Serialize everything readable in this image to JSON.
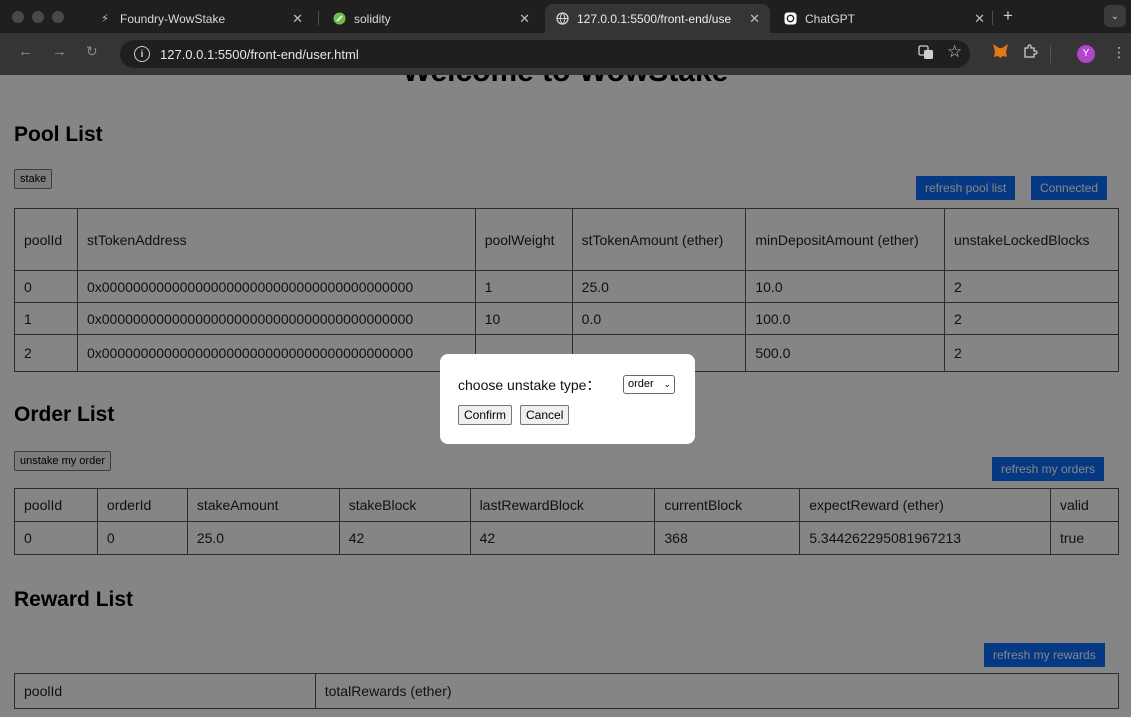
{
  "browser": {
    "tabs": [
      {
        "title": "Foundry-WowStake",
        "icon": "foundry-icon"
      },
      {
        "title": "solidity",
        "icon": "solidity-icon"
      },
      {
        "title": "127.0.0.1:5500/front-end/use",
        "icon": "globe-icon"
      },
      {
        "title": "ChatGPT",
        "icon": "chatgpt-icon"
      }
    ],
    "url": "127.0.0.1:5500/front-end/user.html",
    "profile_initial": "Y"
  },
  "page": {
    "welcome": "Welcome to WowStake",
    "pool": {
      "heading": "Pool List",
      "stake_label": "stake",
      "refresh_label": "refresh pool list",
      "connected_label": "Connected",
      "columns": [
        "poolId",
        "stTokenAddress",
        "poolWeight",
        "stTokenAmount (ether)",
        "minDepositAmount (ether)",
        "unstakeLockedBlocks"
      ],
      "rows": [
        [
          "0",
          "0x0000000000000000000000000000000000000000",
          "1",
          "25.0",
          "10.0",
          "2"
        ],
        [
          "1",
          "0x0000000000000000000000000000000000000000",
          "10",
          "0.0",
          "100.0",
          "2"
        ],
        [
          "2",
          "0x0000000000000000000000000000000000000000",
          "",
          "",
          "500.0",
          "2"
        ]
      ]
    },
    "order": {
      "heading": "Order List",
      "unstake_label": "unstake my order",
      "refresh_label": "refresh my orders",
      "columns": [
        "poolId",
        "orderId",
        "stakeAmount",
        "stakeBlock",
        "lastRewardBlock",
        "currentBlock",
        "expectReward (ether)",
        "valid"
      ],
      "rows": [
        [
          "0",
          "0",
          "25.0",
          "42",
          "42",
          "368",
          "5.344262295081967213",
          "true"
        ]
      ]
    },
    "reward": {
      "heading": "Reward List",
      "refresh_label": "refresh my rewards",
      "columns": [
        "poolId",
        "totalRewards (ether)"
      ]
    }
  },
  "modal": {
    "label": "choose unstake type：",
    "select_value": "order",
    "confirm_label": "Confirm",
    "cancel_label": "Cancel"
  },
  "colors": {
    "primary_button": "#0d6efd",
    "overlay": "rgba(0,0,0,0.48)"
  }
}
